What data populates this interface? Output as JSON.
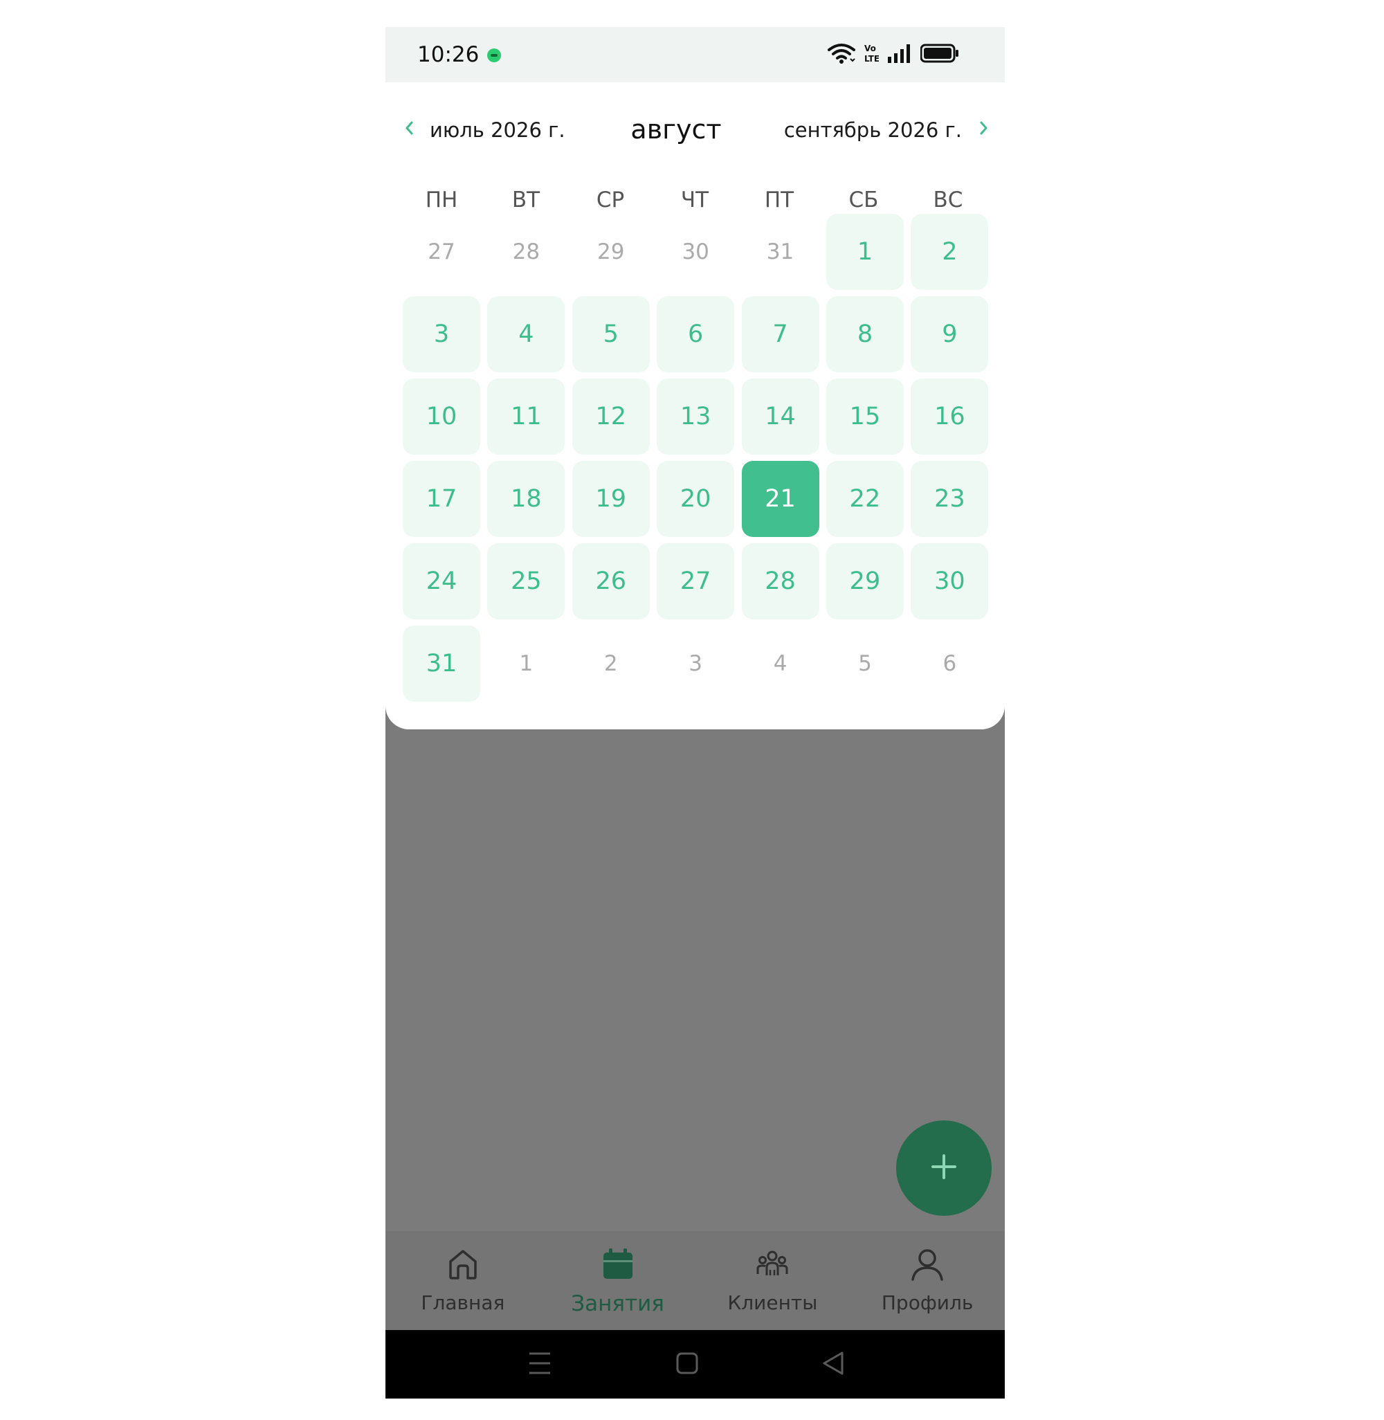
{
  "status_bar": {
    "time": "10:26",
    "icons": [
      "message-notification-icon",
      "wifi-icon",
      "volte-icon",
      "signal-icon",
      "battery-icon"
    ]
  },
  "calendar": {
    "prev_month_label": "июль 2026 г.",
    "current_month_label": "август",
    "next_month_label": "сентябрь 2026 г.",
    "weekdays": [
      "ПН",
      "ВТ",
      "СР",
      "ЧТ",
      "ПТ",
      "СБ",
      "ВС"
    ],
    "days": [
      {
        "label": "27",
        "state": "other"
      },
      {
        "label": "28",
        "state": "other"
      },
      {
        "label": "29",
        "state": "other"
      },
      {
        "label": "30",
        "state": "other"
      },
      {
        "label": "31",
        "state": "other"
      },
      {
        "label": "1",
        "state": "active"
      },
      {
        "label": "2",
        "state": "active"
      },
      {
        "label": "3",
        "state": "active"
      },
      {
        "label": "4",
        "state": "active"
      },
      {
        "label": "5",
        "state": "active"
      },
      {
        "label": "6",
        "state": "active"
      },
      {
        "label": "7",
        "state": "active"
      },
      {
        "label": "8",
        "state": "active"
      },
      {
        "label": "9",
        "state": "active"
      },
      {
        "label": "10",
        "state": "active"
      },
      {
        "label": "11",
        "state": "active"
      },
      {
        "label": "12",
        "state": "active"
      },
      {
        "label": "13",
        "state": "active"
      },
      {
        "label": "14",
        "state": "active"
      },
      {
        "label": "15",
        "state": "active"
      },
      {
        "label": "16",
        "state": "active"
      },
      {
        "label": "17",
        "state": "active"
      },
      {
        "label": "18",
        "state": "active"
      },
      {
        "label": "19",
        "state": "active"
      },
      {
        "label": "20",
        "state": "active"
      },
      {
        "label": "21",
        "state": "selected"
      },
      {
        "label": "22",
        "state": "active"
      },
      {
        "label": "23",
        "state": "active"
      },
      {
        "label": "24",
        "state": "active"
      },
      {
        "label": "25",
        "state": "active"
      },
      {
        "label": "26",
        "state": "active"
      },
      {
        "label": "27",
        "state": "active"
      },
      {
        "label": "28",
        "state": "active"
      },
      {
        "label": "29",
        "state": "active"
      },
      {
        "label": "30",
        "state": "active"
      },
      {
        "label": "31",
        "state": "active"
      },
      {
        "label": "1",
        "state": "other"
      },
      {
        "label": "2",
        "state": "other"
      },
      {
        "label": "3",
        "state": "other"
      },
      {
        "label": "4",
        "state": "other"
      },
      {
        "label": "5",
        "state": "other"
      },
      {
        "label": "6",
        "state": "other"
      }
    ]
  },
  "fab": {
    "icon": "plus-icon"
  },
  "bottom_nav": {
    "items": [
      {
        "label": "Главная",
        "icon": "home-icon",
        "active": false
      },
      {
        "label": "Занятия",
        "icon": "calendar-icon",
        "active": true
      },
      {
        "label": "Клиенты",
        "icon": "clients-icon",
        "active": false
      },
      {
        "label": "Профиль",
        "icon": "profile-icon",
        "active": false
      }
    ]
  },
  "system_nav": {
    "icons": [
      "menu-icon",
      "home-square-icon",
      "back-triangle-icon"
    ]
  },
  "colors": {
    "accent": "#41bf8e",
    "accent_text": "#3dbd8c",
    "day_bg": "#eef9f4",
    "fab_bg": "#236d4d",
    "active_nav": "#1e5b42",
    "overlay": "#7a7b7a"
  }
}
